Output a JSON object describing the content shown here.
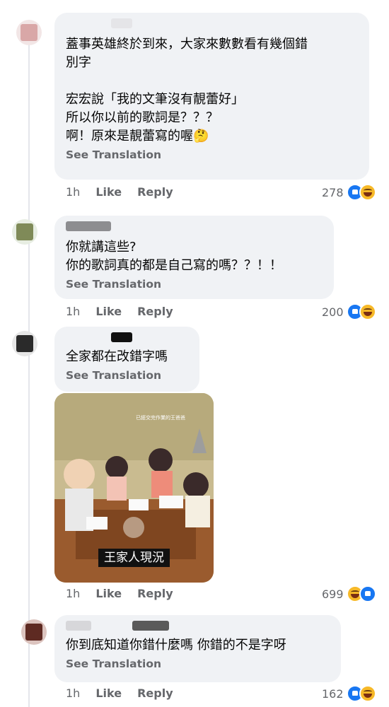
{
  "translate_label": "See Translation",
  "comments": [
    {
      "text": "蓋事英雄終於到來，大家來數數看有幾個錯\n別字\n\n宏宏說「我的文筆沒有靚蕾好」\n所以你以前的歌詞是？？？\n啊！原來是靚蕾寫的喔🤔",
      "time": "1h",
      "like_label": "Like",
      "reply_label": "Reply",
      "reaction_count": "278",
      "reactions": [
        "like-icon",
        "haha-icon"
      ]
    },
    {
      "text": "你就講這些?\n你的歌詞真的都是自己寫的嗎？？！！",
      "time": "1h",
      "like_label": "Like",
      "reply_label": "Reply",
      "reaction_count": "200",
      "reactions": [
        "like-icon",
        "haha-icon"
      ]
    },
    {
      "text": "全家都在改錯字嗎",
      "time": "1h",
      "like_label": "Like",
      "reply_label": "Reply",
      "reaction_count": "699",
      "reactions": [
        "haha-icon",
        "like-icon"
      ],
      "image_label_small": "已經交完作業的王爸爸",
      "image_caption": "王家人現況"
    },
    {
      "text": "你到底知道你錯什麼嗎 你錯的不是字呀",
      "time": "1h",
      "like_label": "Like",
      "reply_label": "Reply",
      "reaction_count": "162",
      "reactions": [
        "like-icon",
        "haha-icon"
      ]
    }
  ],
  "colors": {
    "bubble": "#f0f2f5",
    "secondary_text": "#65676b",
    "like_blue": "#1877f2",
    "haha_yellow": "#f7b928"
  }
}
